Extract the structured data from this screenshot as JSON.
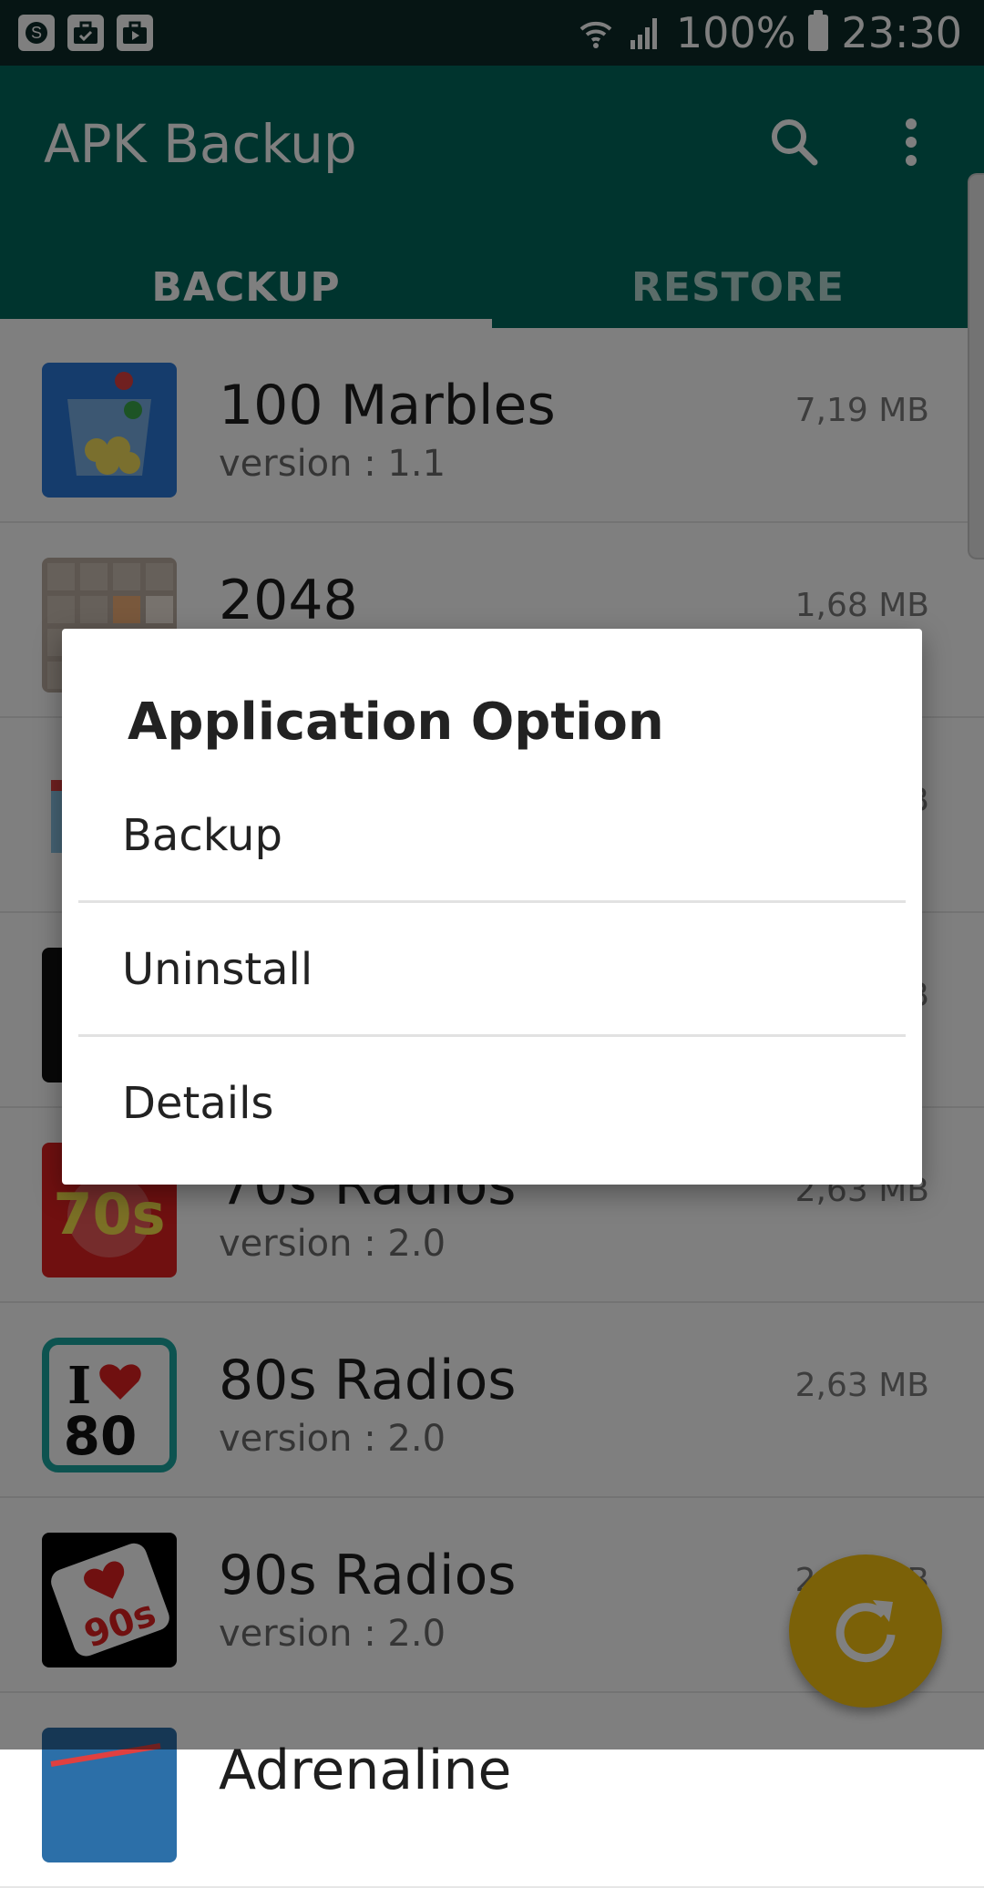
{
  "status_bar": {
    "battery": "100%",
    "time": "23:30",
    "icons": [
      "skype-icon",
      "briefcase-check-icon",
      "play-store-icon",
      "wifi-icon",
      "signal-icon",
      "battery-icon"
    ]
  },
  "app_bar": {
    "title": "APK Backup",
    "search_icon": "search-icon",
    "more_icon": "more-vert-icon",
    "tabs": [
      {
        "label": "BACKUP",
        "selected": true
      },
      {
        "label": "RESTORE",
        "selected": false
      }
    ],
    "color": "#00695c"
  },
  "apps": [
    {
      "name": "100 Marbles",
      "version": "version : 1.1",
      "size": "7,19 MB"
    },
    {
      "name": "2048",
      "version": "",
      "size": "1,68 MB"
    },
    {
      "name": "",
      "version": "",
      "size": "B"
    },
    {
      "name": "",
      "version": "",
      "size": "B"
    },
    {
      "name": "70s Radios",
      "version": "version : 2.0",
      "size": "2,63 MB"
    },
    {
      "name": "80s Radios",
      "version": "version : 2.0",
      "size": "2,63 MB"
    },
    {
      "name": "90s Radios",
      "version": "version : 2.0",
      "size": "2,63 MB"
    },
    {
      "name": "Adrenaline",
      "version": "",
      "size": ""
    }
  ],
  "dialog": {
    "title": "Application Option",
    "options": [
      "Backup",
      "Uninstall",
      "Details"
    ]
  },
  "fab": {
    "icon": "refresh-icon",
    "color": "#f6c10f"
  }
}
